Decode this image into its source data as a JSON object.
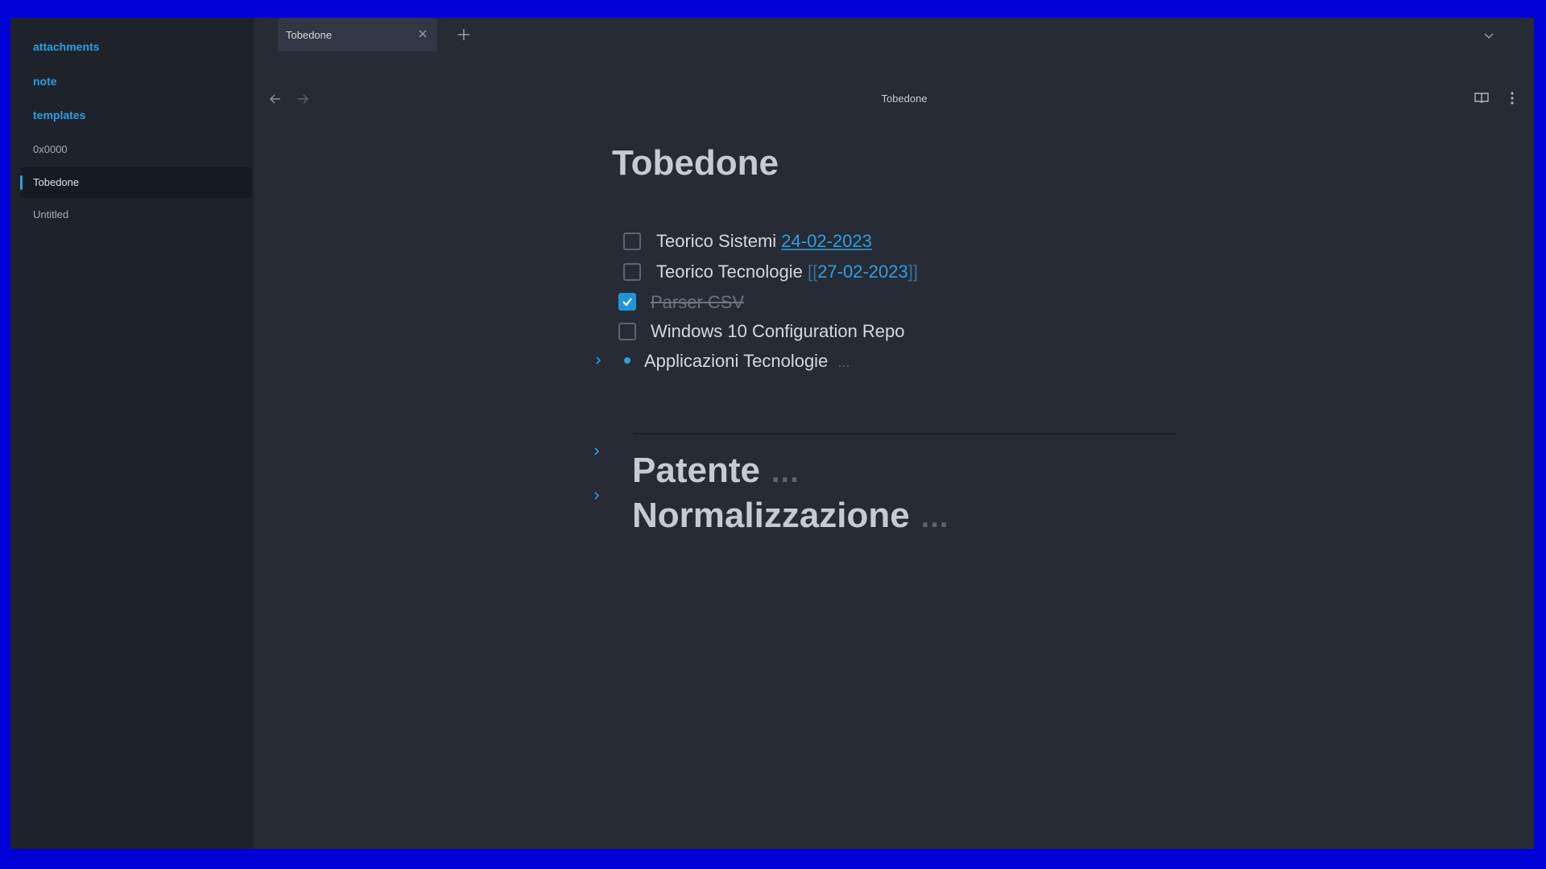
{
  "sidebar": {
    "items": [
      {
        "label": "attachments",
        "kind": "folder"
      },
      {
        "label": "note",
        "kind": "folder"
      },
      {
        "label": "templates",
        "kind": "folder"
      },
      {
        "label": "0x0000",
        "kind": "file"
      },
      {
        "label": "Tobedone",
        "kind": "file",
        "active": true
      },
      {
        "label": "Untitled",
        "kind": "file"
      }
    ]
  },
  "tabs": [
    {
      "label": "Tobedone",
      "close_icon": "close-icon"
    }
  ],
  "header": {
    "title": "Tobedone"
  },
  "document": {
    "title": "Tobedone",
    "tasks": [
      {
        "text": "Teorico Sistemi",
        "link": "24-02-2023",
        "checked": false
      },
      {
        "text": "Teorico Tecnologie",
        "wikilink_open": "[[",
        "wikilink": "27-02-2023",
        "wikilink_close": "]]",
        "checked": false
      },
      {
        "text": "Parser CSV",
        "checked": true
      },
      {
        "text": "Windows 10 Configuration Repo",
        "checked": false
      }
    ],
    "bullet": {
      "text": "Applicazioni Tecnologie",
      "collapsed_marker": "..."
    },
    "headings": [
      {
        "text": "Patente",
        "collapsed_marker": "..."
      },
      {
        "text": "Normalizzazione",
        "collapsed_marker": "..."
      }
    ]
  },
  "colors": {
    "accent": "#2e9fe0",
    "background": "#262b36",
    "sidebar": "#1e232b",
    "frame": "#0000d8"
  }
}
